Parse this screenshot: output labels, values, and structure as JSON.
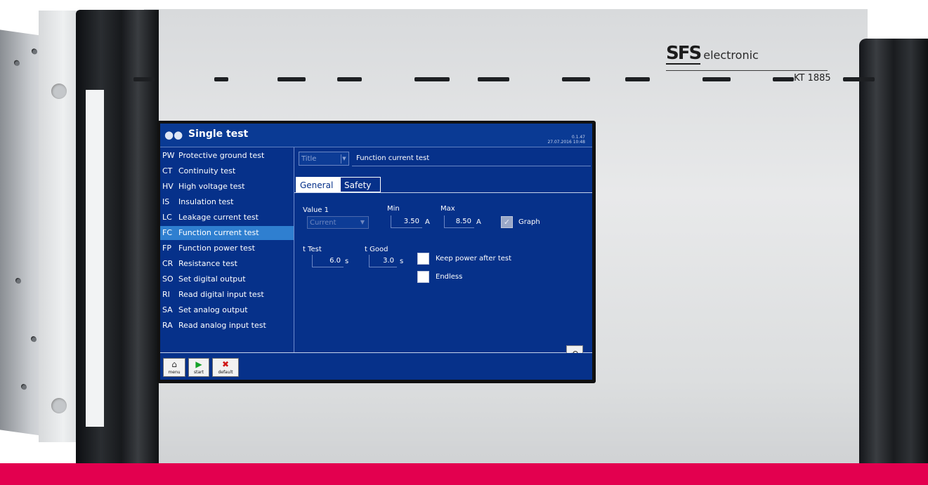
{
  "device": {
    "brand_mark": "SFS",
    "brand_text": "electronic",
    "model": "KT 1885"
  },
  "colors": {
    "screen_bg": "#06318a",
    "active_item": "#2f7fd0",
    "band": "#e3004f"
  },
  "header": {
    "icon": "cluster-icon",
    "title": "Single test",
    "version": "0.1.47",
    "datetime": "27.07.2016 10:48"
  },
  "sidebar": {
    "items": [
      {
        "code": "PW",
        "label": "Protective ground test"
      },
      {
        "code": "CT",
        "label": "Continuity test"
      },
      {
        "code": "HV",
        "label": "High voltage test"
      },
      {
        "code": "IS",
        "label": "Insulation test"
      },
      {
        "code": "LC",
        "label": "Leakage current test"
      },
      {
        "code": "FC",
        "label": "Function current test"
      },
      {
        "code": "FP",
        "label": "Function power test"
      },
      {
        "code": "CR",
        "label": "Resistance test"
      },
      {
        "code": "SO",
        "label": "Set digital output"
      },
      {
        "code": "RI",
        "label": "Read digital input test"
      },
      {
        "code": "SA",
        "label": "Set analog output"
      },
      {
        "code": "RA",
        "label": "Read analog input test"
      }
    ],
    "selected": "FC"
  },
  "form": {
    "title_select": "Title",
    "title_value": "Function current test",
    "tabs": [
      "General",
      "Safety"
    ],
    "value1_label": "Value 1",
    "value1_select": "Current",
    "min_label": "Min",
    "min_value": "3.50",
    "min_unit": "A",
    "max_label": "Max",
    "max_value": "8.50",
    "max_unit": "A",
    "graph_label": "Graph",
    "graph_checked": true,
    "ttest_label": "t Test",
    "ttest_value": "6.0",
    "ttest_unit": "s",
    "tgood_label": "t Good",
    "tgood_value": "3.0",
    "tgood_unit": "s",
    "keep_power_label": "Keep power after test",
    "endless_label": "Endless"
  },
  "toolbar": {
    "menu_label": "menu",
    "start_label": "start",
    "default_label": "default"
  }
}
